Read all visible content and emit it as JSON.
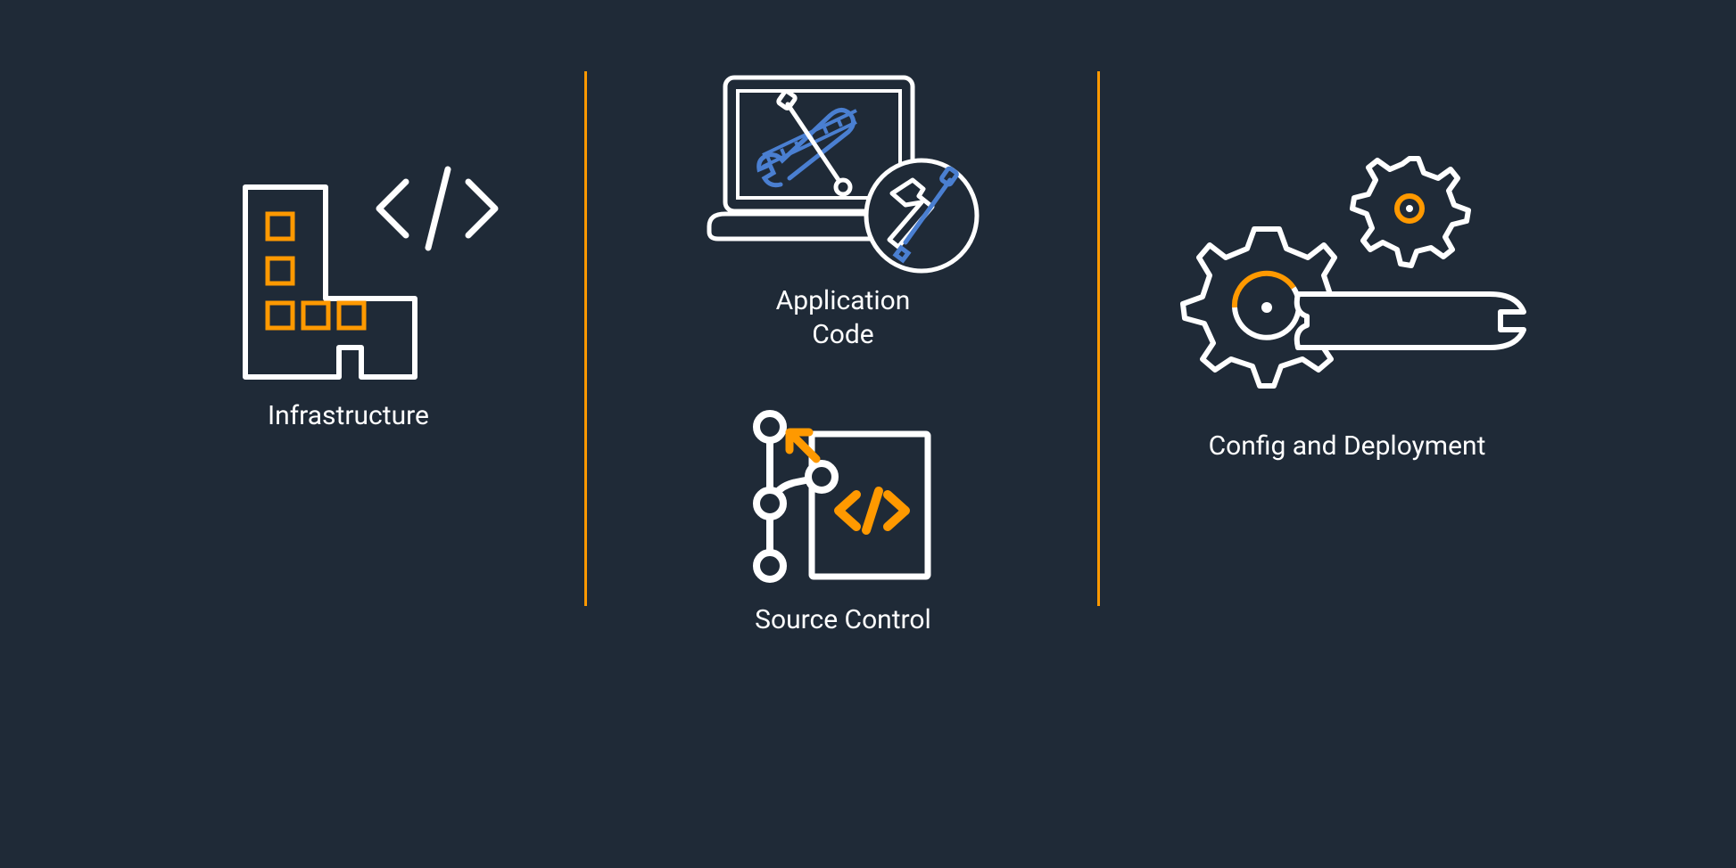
{
  "columns": {
    "infrastructure": {
      "label": "Infrastructure"
    },
    "application_code": {
      "label": "Application\nCode"
    },
    "source_control": {
      "label": "Source Control"
    },
    "config_deployment": {
      "label": "Config and Deployment"
    }
  },
  "colors": {
    "bg": "#1f2a37",
    "white": "#ffffff",
    "orange": "#ff9900",
    "blue": "#4a7fd1"
  }
}
